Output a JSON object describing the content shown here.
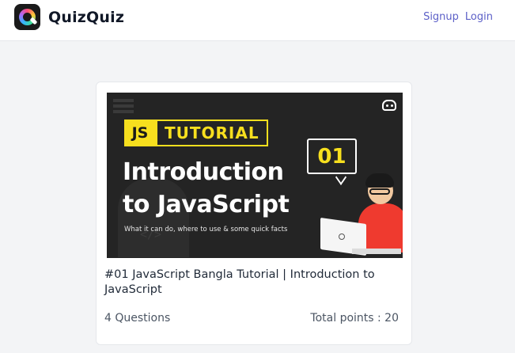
{
  "brand": {
    "name": "QuizQuiz",
    "icon": "quizquiz-logo-icon"
  },
  "nav": {
    "signup_label": "Signup",
    "login_label": "Login"
  },
  "quiz_card": {
    "thumbnail": {
      "badge_js": "JS",
      "badge_word": "TUTORIAL",
      "title_line1": "Introduction",
      "title_line2": "to JavaScript",
      "subtitle": "What it can do, where to use & some quick facts",
      "episode": "01",
      "ghost_code": "</>"
    },
    "title": "#01 JavaScript Bangla Tutorial | Introduction to JavaScript",
    "questions": "4 Questions",
    "total_points": "Total points : 20"
  },
  "colors": {
    "accent_link": "#5b5fc7",
    "js_yellow": "#f7df1e",
    "thumbnail_bg": "#242424",
    "page_bg": "#f3f4f6"
  }
}
